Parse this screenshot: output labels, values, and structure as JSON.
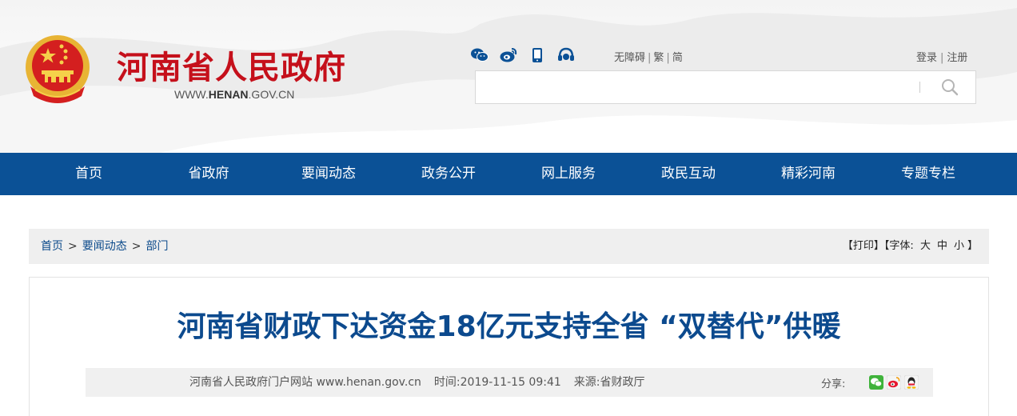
{
  "header": {
    "site_title": "河南省人民政府",
    "site_url_prefix": "WWW.",
    "site_url_domain": "HENAN",
    "site_url_suffix": ".GOV.CN",
    "social_icons": [
      "wechat-icon",
      "weibo-icon",
      "mobile-icon",
      "headset-icon"
    ],
    "lang_links": {
      "accessible": "无障碍",
      "traditional": "繁",
      "simplified": "简"
    },
    "auth_links": {
      "login": "登录",
      "register": "注册"
    },
    "search": {
      "placeholder": "",
      "icon": "search-icon"
    }
  },
  "nav": {
    "items": [
      "首页",
      "省政府",
      "要闻动态",
      "政务公开",
      "网上服务",
      "政民互动",
      "精彩河南",
      "专题专栏"
    ]
  },
  "breadcrumb": {
    "items": [
      "首页",
      "要闻动态",
      "部门"
    ],
    "separator": ">"
  },
  "tools": {
    "print": "【打印】",
    "font_label": "【字体:",
    "font_large": "大",
    "font_medium": "中",
    "font_small": "小",
    "font_close": "】"
  },
  "article": {
    "title": "河南省财政下达资金18亿元支持全省 “双替代”供暖",
    "source_site": "河南省人民政府门户网站 www.henan.gov.cn",
    "time_label": "时间:",
    "time_value": "2019-11-15 09:41",
    "origin_label": "来源:",
    "origin_value": "省财政厅",
    "share_label": "分享:",
    "share_icons": [
      "wechat-share-icon",
      "weibo-share-icon",
      "qq-share-icon"
    ]
  },
  "colors": {
    "brand_red": "#c5101b",
    "nav_blue": "#0b5196",
    "title_blue": "#0c4a8e",
    "link_blue": "#0b4a8b"
  }
}
